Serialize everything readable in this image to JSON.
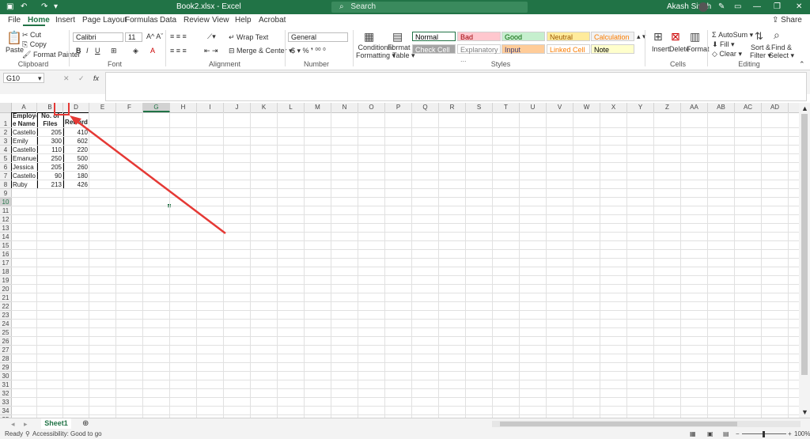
{
  "titlebar": {
    "title": "Book2.xlsx  -  Excel",
    "search_placeholder": "Search",
    "user": "Akash Singh",
    "share": "Share",
    "color": "#217346"
  },
  "tabs": [
    "File",
    "Home",
    "Insert",
    "Page Layout",
    "Formulas",
    "Data",
    "Review",
    "View",
    "Help",
    "Acrobat"
  ],
  "ribbon": {
    "clipboard": {
      "paste": "Paste",
      "cut": "Cut",
      "copy": "Copy",
      "format_painter": "Format Painter",
      "group": "Clipboard"
    },
    "font": {
      "name": "Calibri",
      "size": "11",
      "group": "Font"
    },
    "alignment": {
      "wrap": "Wrap Text",
      "merge": "Merge & Center",
      "group": "Alignment"
    },
    "number": {
      "format": "General",
      "group": "Number"
    },
    "styles": {
      "conditional": "Conditional Formatting",
      "format_table": "Format as Table",
      "cells": [
        {
          "label": "Normal",
          "bg": "#ffffff",
          "fg": "#000000"
        },
        {
          "label": "Bad",
          "bg": "#ffc7ce",
          "fg": "#9c0006"
        },
        {
          "label": "Good",
          "bg": "#c6efce",
          "fg": "#006100"
        },
        {
          "label": "Neutral",
          "bg": "#ffeb9c",
          "fg": "#9c5700"
        },
        {
          "label": "Calculation",
          "bg": "#f2f2f2",
          "fg": "#fa7d00"
        },
        {
          "label": "Check Cell",
          "bg": "#a5a5a5",
          "fg": "#ffffff"
        },
        {
          "label": "Explanatory ...",
          "bg": "#ffffff",
          "fg": "#7f7f7f"
        },
        {
          "label": "Input",
          "bg": "#ffcc99",
          "fg": "#3f3f76"
        },
        {
          "label": "Linked Cell",
          "bg": "#ffffff",
          "fg": "#fa7d00"
        },
        {
          "label": "Note",
          "bg": "#ffffcc",
          "fg": "#000000"
        }
      ],
      "group": "Styles"
    },
    "cells": {
      "insert": "Insert",
      "delete": "Delete",
      "format": "Format",
      "group": "Cells"
    },
    "editing": {
      "autosum": "AutoSum",
      "fill": "Fill",
      "clear": "Clear",
      "sort": "Sort & Filter",
      "find": "Find & Select",
      "group": "Editing"
    }
  },
  "formula_bar": {
    "name_box": "G10",
    "fx": "fx",
    "value": ""
  },
  "columns": [
    "A",
    "B",
    "D",
    "E",
    "F",
    "G",
    "H",
    "I",
    "J",
    "K",
    "L",
    "M",
    "N",
    "O",
    "P",
    "Q",
    "R",
    "S",
    "T",
    "U",
    "V",
    "W",
    "X",
    "Y",
    "Z",
    "AA",
    "AB",
    "AC",
    "AD"
  ],
  "rows": [
    "1",
    "2",
    "3",
    "4",
    "5",
    "6",
    "7",
    "8",
    "9",
    "10",
    "11",
    "12",
    "13",
    "14",
    "15",
    "16",
    "17",
    "18",
    "19",
    "20",
    "21",
    "22",
    "23",
    "24",
    "25",
    "26",
    "27",
    "28",
    "29",
    "30",
    "31",
    "32",
    "33",
    "34",
    "35"
  ],
  "table": {
    "headers": [
      "Employe e Name",
      "No. of Files",
      "Reward"
    ],
    "header_a_line1": "Employe",
    "header_a_line2": "e Name",
    "header_b_line1": "No. of",
    "header_b_line2": "Files",
    "rows": [
      [
        "Castello",
        "205",
        "410"
      ],
      [
        "Emily",
        "300",
        "602"
      ],
      [
        "Castello",
        "110",
        "220"
      ],
      [
        "Emanuel",
        "250",
        "500"
      ],
      [
        "Jessica",
        "205",
        "260"
      ],
      [
        "Castello",
        "90",
        "180"
      ],
      [
        "Ruby",
        "213",
        "426"
      ]
    ]
  },
  "sheet": {
    "tab": "Sheet1"
  },
  "status": {
    "ready": "Ready",
    "accessibility": "Accessibility: Good to go",
    "zoom": "100%"
  },
  "annotation": {
    "color": "#e53935"
  }
}
